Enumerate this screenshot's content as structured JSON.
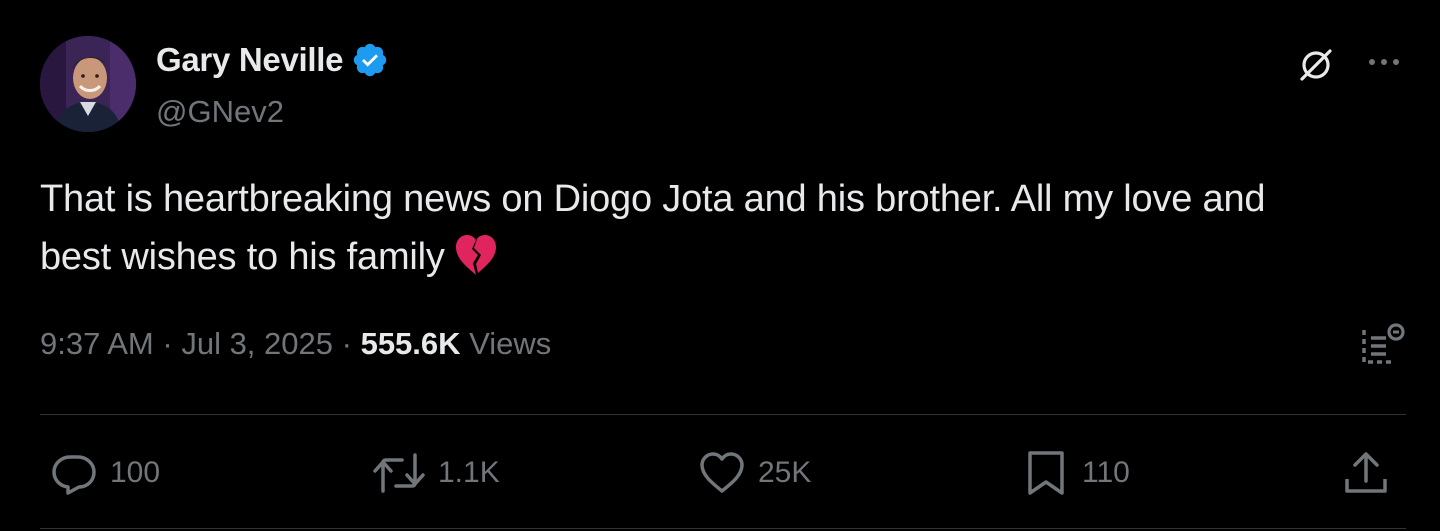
{
  "author": {
    "display_name": "Gary Neville",
    "handle": "@GNev2",
    "verified": true,
    "avatar_icon": "avatar-photo",
    "verified_color": "#1d9bf0"
  },
  "tweet": {
    "line1": "That is heartbreaking news on Diogo Jota and his brother. All my love and",
    "line2": "best wishes to his family",
    "emoji": "broken-heart"
  },
  "meta": {
    "time": "9:37 AM",
    "separator": "·",
    "date": "Jul 3, 2025",
    "views_count": "555.6K",
    "views_label": "Views"
  },
  "actions": {
    "reply": {
      "count": "100",
      "icon": "reply-icon"
    },
    "retweet": {
      "count": "1.1K",
      "icon": "retweet-icon"
    },
    "like": {
      "count": "25K",
      "icon": "heart-icon"
    },
    "bookmark": {
      "count": "110",
      "icon": "bookmark-icon"
    },
    "share": {
      "icon": "share-icon"
    }
  },
  "header_icons": [
    "grok-icon",
    "more-icon"
  ],
  "colors": {
    "background": "#000000",
    "text": "#e7e9ea",
    "muted": "#71767b",
    "divider": "#2f3336",
    "emoji_red": "#e0245e"
  }
}
